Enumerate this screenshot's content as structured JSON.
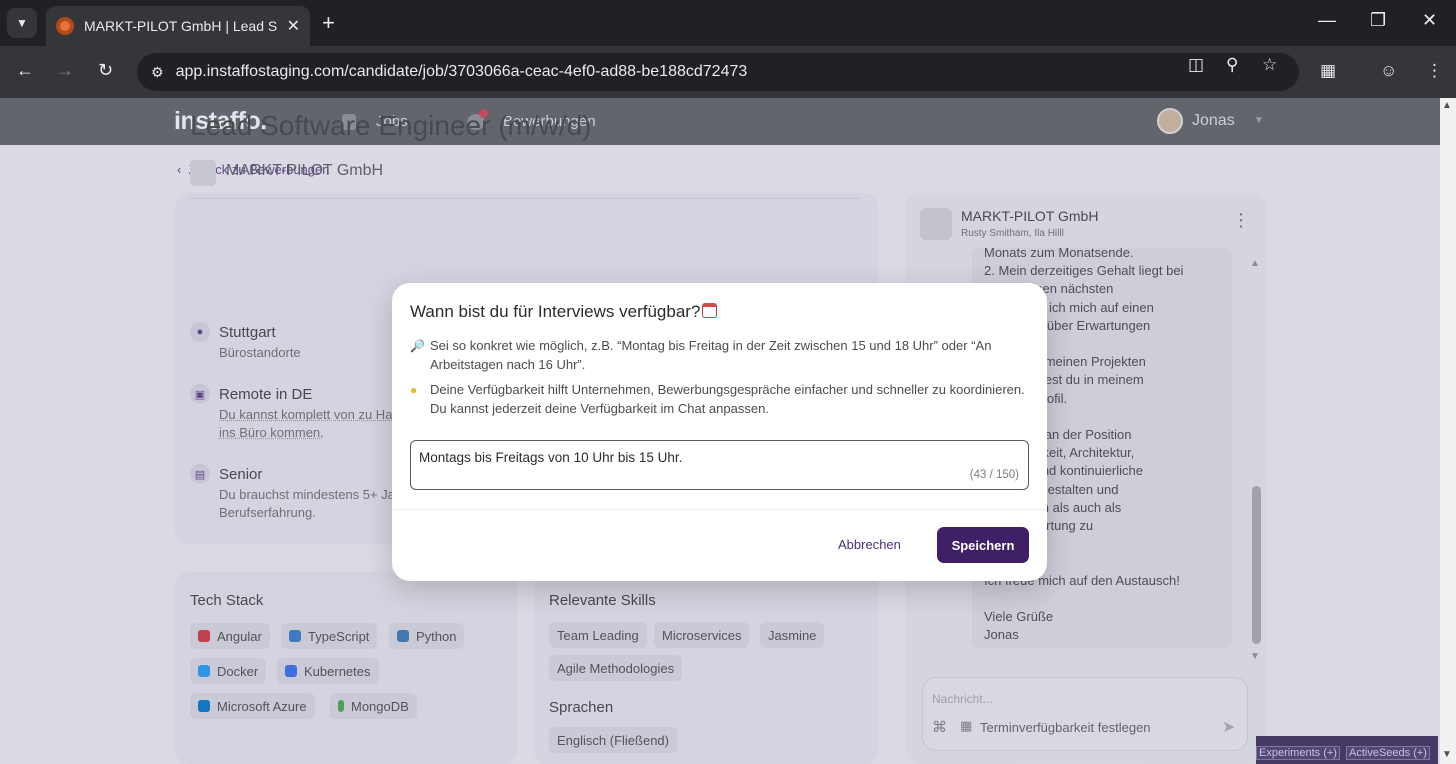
{
  "browser": {
    "tab_title": "MARKT-PILOT GmbH | Lead Sof",
    "url": "app.instaffostaging.com/candidate/job/3703066a-ceac-4ef0-ad88-be188cd72473"
  },
  "appbar": {
    "logo": "instaffo.",
    "nav_jobs": "Jobs",
    "nav_applications": "Bewerbungen",
    "user_name": "Jonas"
  },
  "back_link": "Zurück zu Bewerbungen",
  "job": {
    "title": "Lead Software Engineer (m/w/d)",
    "company": "MARKT-PILOT GmbH",
    "facets": [
      {
        "title": "Stuttgart",
        "sub": "Bürostandorte"
      },
      {
        "title": "Remote in DE",
        "sub": "Du kannst komplett von zu Ha\nins Büro kommen."
      },
      {
        "title": "Senior",
        "sub": "Du brauchst mindestens 5+ Ja\nBerufserfahrung."
      }
    ]
  },
  "tech_stack": {
    "title": "Tech Stack",
    "items": [
      "Angular",
      "TypeScript",
      "Python",
      "Docker",
      "Kubernetes",
      "Microsoft Azure",
      "MongoDB"
    ]
  },
  "skills": {
    "title": "Relevante Skills",
    "items": [
      "Team Leading",
      "Microservices",
      "Jasmine",
      "Agile Methodologies"
    ]
  },
  "languages": {
    "title": "Sprachen",
    "items": [
      "Englisch (Fließend)"
    ]
  },
  "chat": {
    "company": "MARKT-PILOT GmbH",
    "people": "Rusty Smitham, Ila Hilll",
    "message": "Monats zum Monatsende.\n2. Mein derzeitiges Gehalt liegt bei\n. Für meinen nächsten\nchritt freue ich mich auf einen\naustausch über Erwartungen\nlität.\nDetails zu meinen Projekten\nungen findest du in meinem\nn CV im Profil.\n\n spannend an der Position\nie Möglichkeit, Architektur,\ncherung und kontinuierliche\nung mitzugestalten und\nohl fachlich als auch als\nr Verantwortung zu\nen.\n\nIch freue mich auf den Austausch!\n\nViele Grüße\nJonas",
    "compose_placeholder": "Nachricht...",
    "availability_action": "Terminverfügbarkeit festlegen"
  },
  "devtools": {
    "experiments": "Experiments (+)",
    "active_seeds": "ActiveSeeds (+)"
  },
  "modal": {
    "title": "Wann bist du für Interviews verfügbar?",
    "hint1": "Sei so konkret wie möglich, z.B. “Montag bis Freitag in der Zeit zwischen 15 und 18 Uhr” oder “An Arbeitstagen nach 16 Uhr”.",
    "hint2": "Deine Verfügbarkeit hilft Unternehmen, Bewerbungsgespräche einfacher und schneller zu koordinieren. Du kannst jederzeit deine Verfügbarkeit im Chat anpassen.",
    "input_value": "Montags bis Freitags von 10 Uhr bis 15 Uhr.",
    "char_count": "(43 / 150)",
    "cancel_label": "Abbrechen",
    "save_label": "Speichern"
  },
  "colors": {
    "primary": "#3f1f66",
    "link": "#5a3c86",
    "appbar": "#5c5f63"
  }
}
